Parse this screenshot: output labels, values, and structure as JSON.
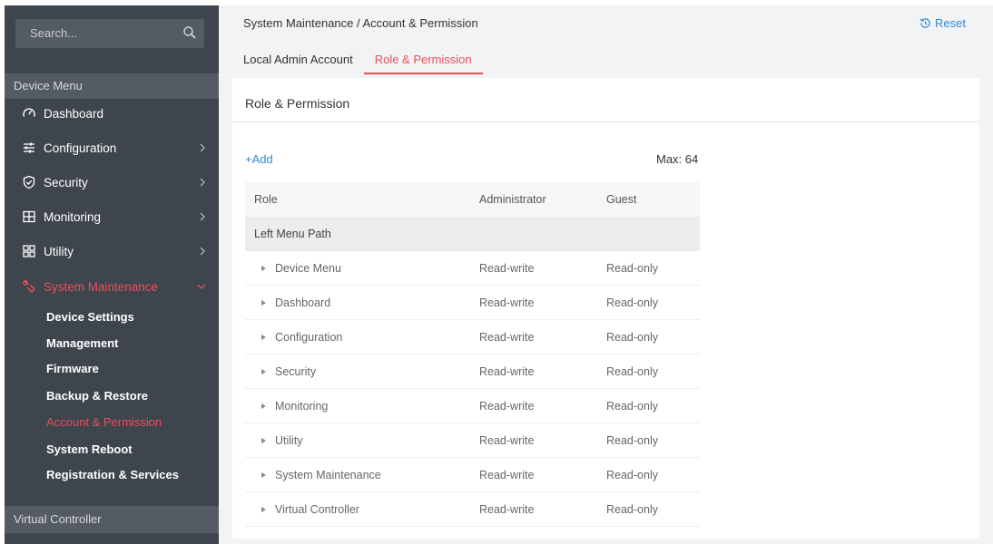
{
  "sidebar": {
    "search_placeholder": "Search...",
    "device_menu_label": "Device Menu",
    "items": [
      {
        "label": "Dashboard",
        "icon": "gauge-icon"
      },
      {
        "label": "Configuration",
        "icon": "sliders-icon"
      },
      {
        "label": "Security",
        "icon": "shield-icon"
      },
      {
        "label": "Monitoring",
        "icon": "monitor-icon"
      },
      {
        "label": "Utility",
        "icon": "grid-icon"
      },
      {
        "label": "System Maintenance",
        "icon": "wrench-icon"
      }
    ],
    "sub_items": [
      {
        "label": "Device Settings"
      },
      {
        "label": "Management"
      },
      {
        "label": "Firmware"
      },
      {
        "label": "Backup & Restore"
      },
      {
        "label": "Account & Permission"
      },
      {
        "label": "System Reboot"
      },
      {
        "label": "Registration & Services"
      }
    ],
    "virtual_controller_label": "Virtual Controller"
  },
  "header": {
    "breadcrumb": "System Maintenance / Account & Permission",
    "reset_label": "Reset",
    "tabs": [
      {
        "label": "Local Admin Account"
      },
      {
        "label": "Role & Permission"
      }
    ]
  },
  "card": {
    "title": "Role & Permission",
    "add_label": "+Add",
    "max_label": "Max: 64"
  },
  "table": {
    "headers": [
      "Role",
      "Administrator",
      "Guest"
    ],
    "group_label": "Left Menu Path",
    "rows": [
      {
        "path": "Device Menu",
        "admin": "Read-write",
        "guest": "Read-only"
      },
      {
        "path": "Dashboard",
        "admin": "Read-write",
        "guest": "Read-only"
      },
      {
        "path": "Configuration",
        "admin": "Read-write",
        "guest": "Read-only"
      },
      {
        "path": "Security",
        "admin": "Read-write",
        "guest": "Read-only"
      },
      {
        "path": "Monitoring",
        "admin": "Read-write",
        "guest": "Read-only"
      },
      {
        "path": "Utility",
        "admin": "Read-write",
        "guest": "Read-only"
      },
      {
        "path": "System Maintenance",
        "admin": "Read-write",
        "guest": "Read-only"
      },
      {
        "path": "Virtual Controller",
        "admin": "Read-write",
        "guest": "Read-only"
      }
    ]
  },
  "colors": {
    "sidebar_bg": "#3e454d",
    "accent_red": "#e8505b",
    "link_blue": "#2d8ad8"
  }
}
